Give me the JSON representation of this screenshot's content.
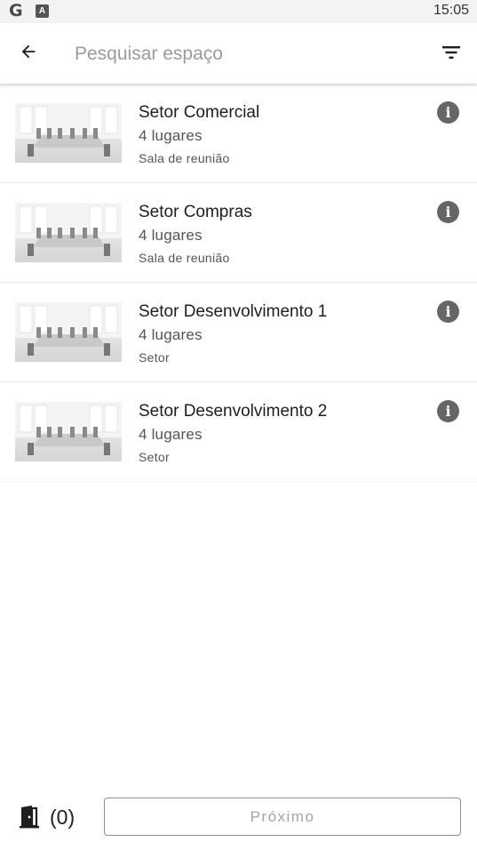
{
  "status_bar": {
    "time": "15:05",
    "google_glyph": "G",
    "app_glyph": "A"
  },
  "search": {
    "placeholder": "Pesquisar espaço",
    "value": ""
  },
  "spaces": [
    {
      "name": "Setor Comercial",
      "capacity": "4 lugares",
      "type": "Sala de reunião"
    },
    {
      "name": "Setor Compras",
      "capacity": "4 lugares",
      "type": "Sala de reunião"
    },
    {
      "name": "Setor Desenvolvimento 1",
      "capacity": "4 lugares",
      "type": "Setor"
    },
    {
      "name": "Setor Desenvolvimento 2",
      "capacity": "4 lugares",
      "type": "Setor"
    }
  ],
  "footer": {
    "selected_count": "(0)",
    "next_label": "Próximo"
  },
  "icons": {
    "back": "arrow-left",
    "filter": "filter-lines",
    "info": "info-circle",
    "door": "door-open",
    "thumbnail": "meeting-room-photo"
  },
  "colors": {
    "accent_icon": "#666666",
    "text_primary": "#1e1e1e",
    "text_secondary": "#555555",
    "disabled_text": "#a4a4a4"
  }
}
